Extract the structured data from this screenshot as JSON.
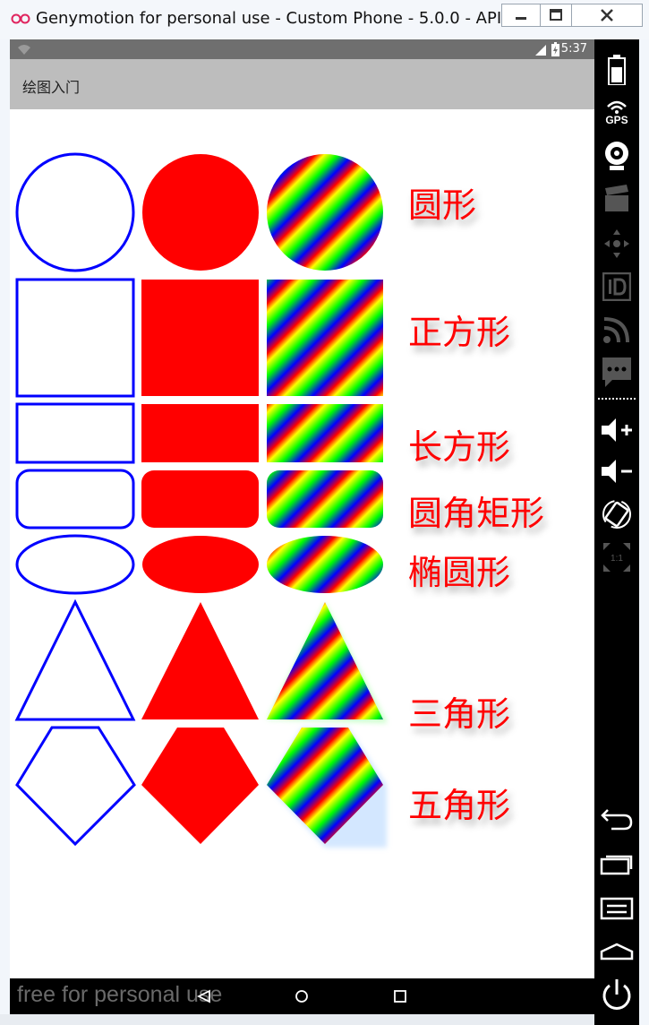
{
  "window": {
    "title": "Genymotion for personal use - Custom Phone - 5.0.0 - API...",
    "controls": [
      "minimize",
      "maximize",
      "close"
    ]
  },
  "status_bar": {
    "time": "5:37"
  },
  "action_bar": {
    "title": "绘图入门"
  },
  "shapes": {
    "fill_colors": {
      "stroke": "#0000ff",
      "fill": "#ff0000",
      "gradient": [
        "#ff0000",
        "#ffff00",
        "#00ff00",
        "#0000ff"
      ]
    },
    "rows": [
      {
        "label": "圆形",
        "shape": "circle"
      },
      {
        "label": "正方形",
        "shape": "square"
      },
      {
        "label": "长方形",
        "shape": "rectangle"
      },
      {
        "label": "圆角矩形",
        "shape": "rounded-rectangle"
      },
      {
        "label": "椭圆形",
        "shape": "ellipse"
      },
      {
        "label": "三角形",
        "shape": "triangle"
      },
      {
        "label": "五角形",
        "shape": "pentagon"
      }
    ]
  },
  "nav_bar": {
    "watermark": "free for personal use",
    "buttons": [
      "back-icon",
      "home-icon",
      "recents-icon"
    ]
  },
  "sidebar": {
    "icons": [
      "battery-icon",
      "gps-icon",
      "webcam-icon",
      "clapper-icon",
      "dpad-icon",
      "id-icon",
      "rss-icon",
      "sms-icon",
      "volume-up-icon",
      "volume-down-icon",
      "rotate-icon",
      "scale-icon",
      "back-icon",
      "recents-icon",
      "menu-icon",
      "home-icon",
      "power-icon"
    ],
    "gps_label": "GPS",
    "scale_label": "1:1"
  }
}
